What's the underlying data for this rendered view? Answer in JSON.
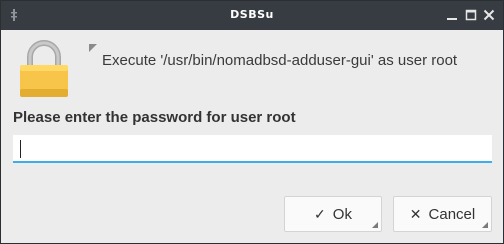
{
  "window": {
    "title": "DSBSu"
  },
  "dialog": {
    "exec_message": "Execute '/usr/bin/nomadbsd-adduser-gui' as user root",
    "prompt": "Please enter the password for user root",
    "password_value": ""
  },
  "buttons": {
    "ok_icon": "✓",
    "ok_label": "Ok",
    "cancel_icon": "✕",
    "cancel_label": "Cancel"
  },
  "icons": {
    "lock": "lock-icon",
    "minimize": "minimize-icon",
    "maximize": "maximize-icon",
    "close": "close-icon"
  },
  "colors": {
    "titlebar": "#373c42",
    "focus_accent": "#3daee9",
    "lock_body": "#f7c54a"
  }
}
